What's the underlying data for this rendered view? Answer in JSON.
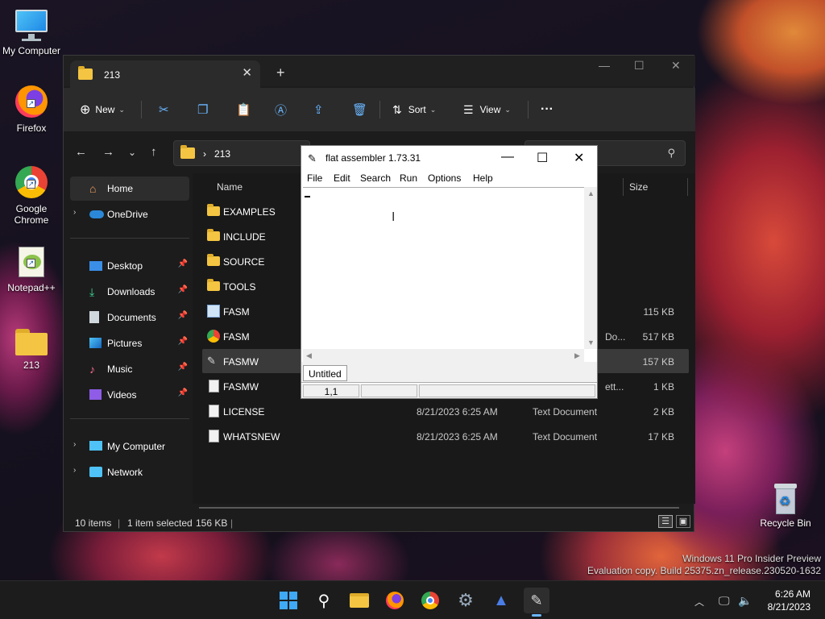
{
  "desktop": {
    "icons": [
      {
        "label": "My Computer"
      },
      {
        "label": "Firefox"
      },
      {
        "label": "Google Chrome"
      },
      {
        "label": "Notepad++"
      },
      {
        "label": "213"
      }
    ],
    "recycle_bin": "Recycle Bin",
    "watermark": {
      "line1": "Windows 11 Pro Insider Preview",
      "line2": "Evaluation copy. Build 25375.zn_release.230520-1632"
    }
  },
  "explorer": {
    "tab_title": "213",
    "toolbar": {
      "new_label": "New",
      "sort_label": "Sort",
      "view_label": "View",
      "more_label": "···"
    },
    "address": {
      "crumb": "213"
    },
    "nav": {
      "items": [
        {
          "label": "Home"
        },
        {
          "label": "OneDrive"
        },
        {
          "label": "Desktop"
        },
        {
          "label": "Downloads"
        },
        {
          "label": "Documents"
        },
        {
          "label": "Pictures"
        },
        {
          "label": "Music"
        },
        {
          "label": "Videos"
        },
        {
          "label": "My Computer"
        },
        {
          "label": "Network"
        }
      ]
    },
    "columns": {
      "name": "Name",
      "size": "Size"
    },
    "files": [
      {
        "name": "EXAMPLES",
        "date": "",
        "type": "",
        "size": ""
      },
      {
        "name": "INCLUDE",
        "date": "",
        "type": "",
        "size": ""
      },
      {
        "name": "SOURCE",
        "date": "",
        "type": "",
        "size": ""
      },
      {
        "name": "TOOLS",
        "date": "",
        "type": "",
        "size": ""
      },
      {
        "name": "FASM",
        "date": "",
        "type": "",
        "size": "115 KB"
      },
      {
        "name": "FASM",
        "date": "",
        "type": "Do...",
        "size": "517 KB"
      },
      {
        "name": "FASMW",
        "date": "",
        "type": "",
        "size": "157 KB"
      },
      {
        "name": "FASMW",
        "date": "",
        "type": "ett...",
        "size": "1 KB"
      },
      {
        "name": "LICENSE",
        "date": "8/21/2023 6:25 AM",
        "type": "Text Document",
        "size": "2 KB"
      },
      {
        "name": "WHATSNEW",
        "date": "8/21/2023 6:25 AM",
        "type": "Text Document",
        "size": "17 KB"
      }
    ],
    "status": {
      "count": "10 items",
      "selected": "1 item selected",
      "size": "156 KB"
    }
  },
  "fasm": {
    "title": "flat assembler 1.73.31",
    "menu": [
      "File",
      "Edit",
      "Search",
      "Run",
      "Options",
      "Help"
    ],
    "tab": "Untitled",
    "position": "1,1"
  },
  "taskbar": {
    "time": "6:26 AM",
    "date": "8/21/2023"
  }
}
